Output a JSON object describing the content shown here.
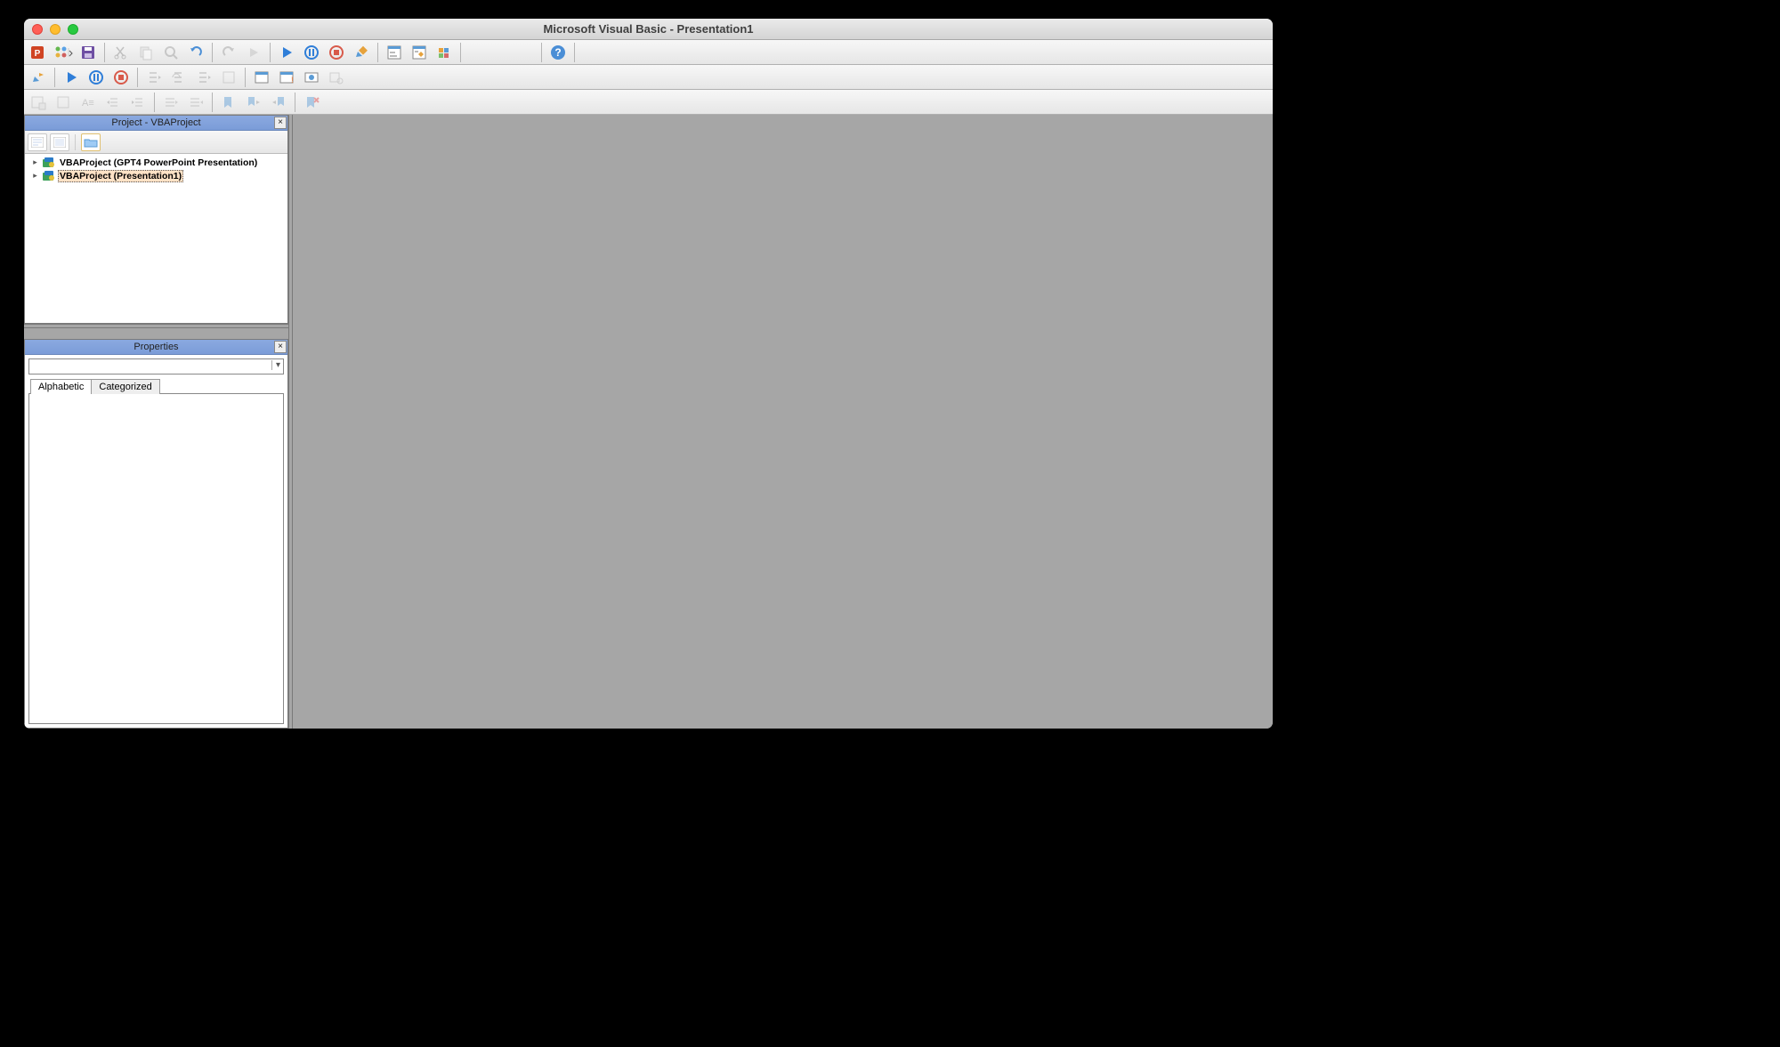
{
  "window": {
    "title": "Microsoft Visual Basic - Presentation1"
  },
  "panels": {
    "project": {
      "title": "Project - VBAProject"
    },
    "properties": {
      "title": "Properties",
      "tabs": {
        "alphabetic": "Alphabetic",
        "categorized": "Categorized"
      }
    }
  },
  "tree": {
    "items": [
      {
        "label": "VBAProject (GPT4 PowerPoint Presentation)"
      },
      {
        "label": "VBAProject (Presentation1)"
      }
    ]
  }
}
